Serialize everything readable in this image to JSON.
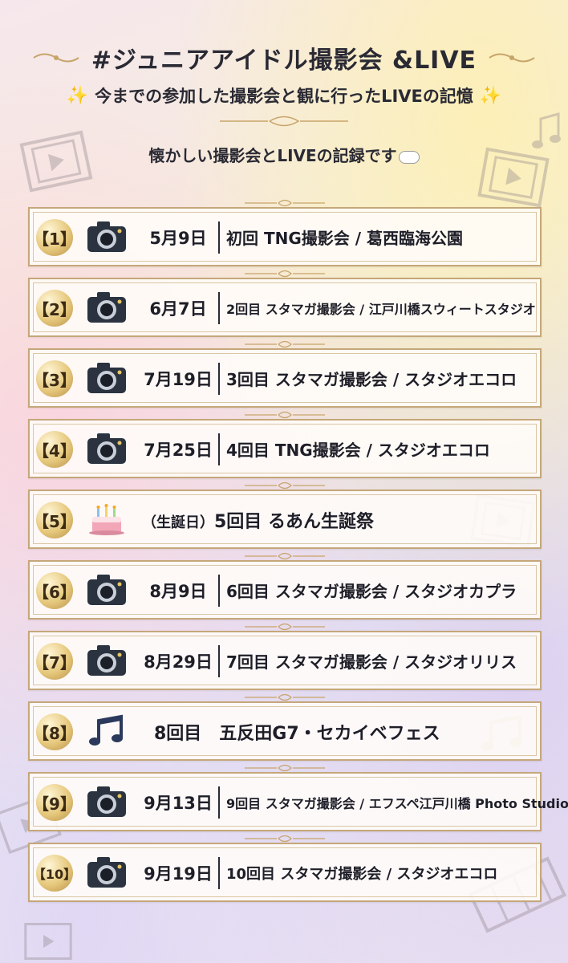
{
  "header": {
    "title": "#ジュニアアイドル撮影会 &LIVE",
    "subtitle": "今までの参加した撮影会と観に行ったLIVEの記憶",
    "intro": "懐かしい撮影会とLIVEの記録です"
  },
  "colors": {
    "gold": "#c5a779",
    "text": "#1e1e28"
  },
  "entries": [
    {
      "num": "【1】",
      "icon": "camera-icon",
      "date": "5月9日",
      "desc": "初回 TNG撮影会 / 葛西臨海公園"
    },
    {
      "num": "【2】",
      "icon": "camera-icon",
      "date": "6月7日",
      "desc": "2回目 スタマガ撮影会 / 江戸川橋スウィートスタジオ"
    },
    {
      "num": "【3】",
      "icon": "camera-icon",
      "date": "7月19日",
      "desc": "3回目 スタマガ撮影会 / スタジオエコロ"
    },
    {
      "num": "【4】",
      "icon": "camera-icon",
      "date": "7月25日",
      "desc": "4回目 TNG撮影会 / スタジオエコロ"
    },
    {
      "num": "【5】",
      "icon": "birthday-cake-icon",
      "label": "（生誕日）",
      "desc": "5回目 るあん生誕祭"
    },
    {
      "num": "【6】",
      "icon": "camera-icon",
      "date": "8月9日",
      "desc": "6回目 スタマガ撮影会 / スタジオカプラ"
    },
    {
      "num": "【7】",
      "icon": "camera-icon",
      "date": "8月29日",
      "desc": "7回目 スタマガ撮影会 / スタジオリリス"
    },
    {
      "num": "【8】",
      "icon": "music-note-icon",
      "desc": "8回目　五反田G7・セカイベフェス"
    },
    {
      "num": "【9】",
      "icon": "camera-icon",
      "date": "9月13日",
      "desc": "9回目 スタマガ撮影会 / エフスペ江戸川橋 Photo Studio"
    },
    {
      "num": "【10】",
      "icon": "camera-icon",
      "date": "9月19日",
      "desc": "10回目 スタマガ撮影会 / スタジオエコロ"
    }
  ]
}
